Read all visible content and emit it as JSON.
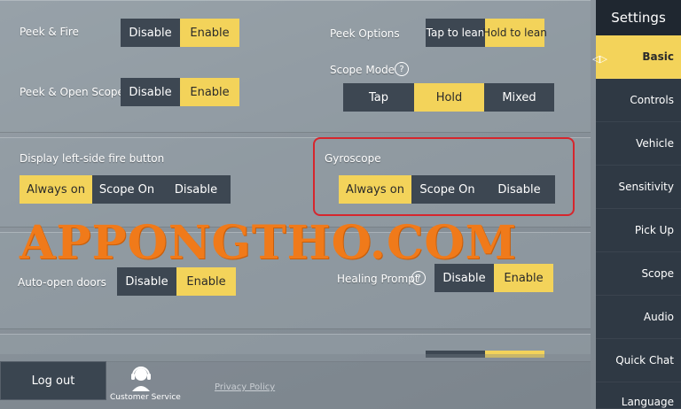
{
  "peek_fire": {
    "label": "Peek & Fire",
    "options": [
      "Disable",
      "Enable"
    ],
    "selected": "Enable"
  },
  "peek_options": {
    "label": "Peek Options",
    "options": [
      "Tap to lean",
      "Hold to lean"
    ],
    "selected": "Hold to lean"
  },
  "peek_open_scope": {
    "label": "Peek & Open Scope",
    "options": [
      "Disable",
      "Enable"
    ],
    "selected": "Enable"
  },
  "scope_mode": {
    "label": "Scope Mode",
    "options": [
      "Tap",
      "Hold",
      "Mixed"
    ],
    "selected": "Hold"
  },
  "left_fire": {
    "label": "Display left-side fire button",
    "options": [
      "Always on",
      "Scope On",
      "Disable"
    ],
    "selected": "Always on"
  },
  "gyroscope": {
    "label": "Gyroscope",
    "options": [
      "Always on",
      "Scope On",
      "Disable"
    ],
    "selected": "Always on"
  },
  "auto_doors": {
    "label": "Auto-open doors",
    "options": [
      "Disable",
      "Enable"
    ],
    "selected": "Enable"
  },
  "healing": {
    "label": "Healing Prompt",
    "options": [
      "Disable",
      "Enable"
    ],
    "selected": "Enable"
  },
  "help_glyph": "?",
  "watermark": "APPONGTHO.COM",
  "sidebar": {
    "title": "Settings",
    "items": [
      "Basic",
      "Controls",
      "Vehicle",
      "Sensitivity",
      "Pick Up",
      "Scope",
      "Audio",
      "Quick Chat",
      "Language"
    ],
    "active": "Basic"
  },
  "footer": {
    "logout": "Log out",
    "customer_service": "Customer Service",
    "privacy": "Privacy Policy"
  },
  "colors": {
    "accent": "#f3d35a",
    "segment_bg": "#3d4752",
    "highlight_frame": "#d6262d",
    "watermark": "#f07a1a"
  }
}
